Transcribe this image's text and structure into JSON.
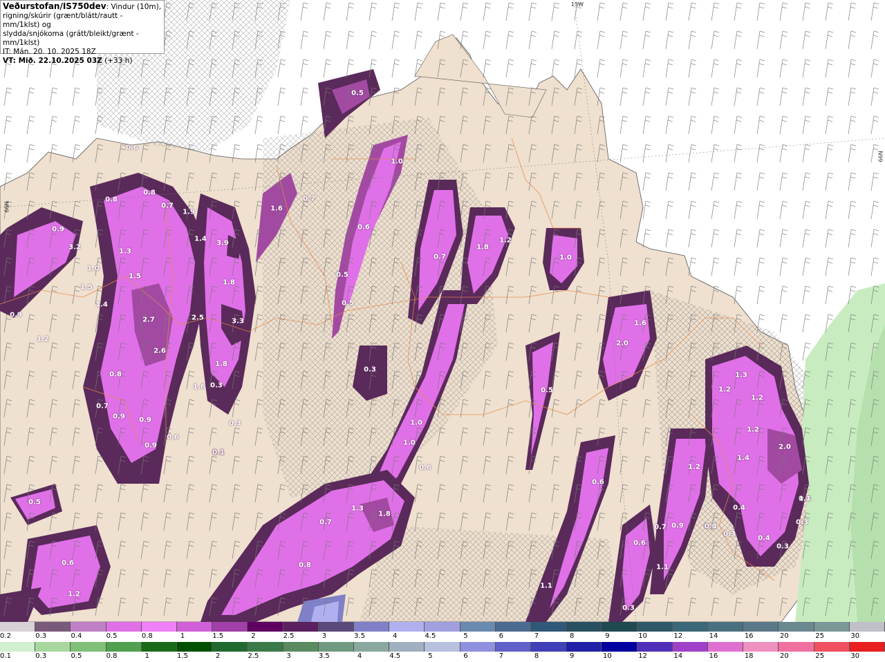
{
  "header": {
    "brand": "Veðurstofan/IS750dev",
    "line1_rest": ": Vindur (10m),",
    "line2": "rigning/skúrir (grænt/blátt/rautt - mm/1klst) og",
    "line3": "slydda/snjókoma (grátt/bleikt/grænt - mm/1klst)",
    "line4": "IT: Mán. 20. 10. 2025 18Z",
    "line5_bold": "VT: Mið. 22.10.2025 03Z",
    "line5_rest": " (+33 h)"
  },
  "grid_labels": {
    "lon_top": "15W",
    "lat_left": "66N",
    "lat_right": "66N"
  },
  "map_colors": {
    "land": "#efe0cf",
    "sea": "#ffffff",
    "roads": "#e8894a",
    "snow_dark": "#5a2a5a",
    "snow_mid": "#a24aa2",
    "snow_bright": "#e070e8",
    "rain_light": "#c8ecc0"
  },
  "value_labels": [
    {
      "text": "0.5"
    },
    {
      "text": "0.6"
    },
    {
      "text": "0.8"
    },
    {
      "text": "0.8"
    },
    {
      "text": "0.7"
    },
    {
      "text": "1.9"
    },
    {
      "text": "0.9"
    },
    {
      "text": "3.2"
    },
    {
      "text": "1.3"
    },
    {
      "text": "1.0"
    },
    {
      "text": "1.5"
    },
    {
      "text": "1.5"
    },
    {
      "text": "1.4"
    },
    {
      "text": "1.4"
    },
    {
      "text": "3.9"
    },
    {
      "text": "1.8"
    },
    {
      "text": "1.6"
    },
    {
      "text": "0.7"
    },
    {
      "text": "1.0"
    },
    {
      "text": "0.6"
    },
    {
      "text": "0.5"
    },
    {
      "text": "0.5"
    },
    {
      "text": "0.7"
    },
    {
      "text": "1.8"
    },
    {
      "text": "1.2"
    },
    {
      "text": "1.0"
    },
    {
      "text": "0.9"
    },
    {
      "text": "1.2"
    },
    {
      "text": "2.7"
    },
    {
      "text": "2.5"
    },
    {
      "text": "3.3"
    },
    {
      "text": "2.6"
    },
    {
      "text": "1.8"
    },
    {
      "text": "0.8"
    },
    {
      "text": "1.6"
    },
    {
      "text": "0.7"
    },
    {
      "text": "0.9"
    },
    {
      "text": "0.9"
    },
    {
      "text": "0.3"
    },
    {
      "text": "0.6"
    },
    {
      "text": "0.9"
    },
    {
      "text": "0.1"
    },
    {
      "text": "0.3"
    },
    {
      "text": "0.3"
    },
    {
      "text": "1.0"
    },
    {
      "text": "1.0"
    },
    {
      "text": "0.6"
    },
    {
      "text": "0.5"
    },
    {
      "text": "2.0"
    },
    {
      "text": "1.6"
    },
    {
      "text": "1.3"
    },
    {
      "text": "1.2"
    },
    {
      "text": "1.2"
    },
    {
      "text": "1.2"
    },
    {
      "text": "2.0"
    },
    {
      "text": "1.4"
    },
    {
      "text": "1.2"
    },
    {
      "text": "0.6"
    },
    {
      "text": "0.5"
    },
    {
      "text": "0.6"
    },
    {
      "text": "0.7"
    },
    {
      "text": "1.3"
    },
    {
      "text": "1.8"
    },
    {
      "text": "0.8"
    },
    {
      "text": "1.2"
    },
    {
      "text": "0.6"
    },
    {
      "text": "0.7"
    },
    {
      "text": "0.3"
    },
    {
      "text": "0.6"
    },
    {
      "text": "1.1"
    },
    {
      "text": "0.9"
    },
    {
      "text": "0.4"
    },
    {
      "text": "0.4"
    },
    {
      "text": "0.3"
    },
    {
      "text": "0.4"
    },
    {
      "text": "0.3"
    },
    {
      "text": "1.1"
    },
    {
      "text": "0.4"
    },
    {
      "text": "0.3"
    },
    {
      "text": "1.1"
    },
    {
      "text": "0.1"
    }
  ],
  "colorbar_snow": {
    "labels": [
      "0.2",
      "0.3",
      "0.4",
      "0.5",
      "0.8",
      "1",
      "1.5",
      "2",
      "2.5",
      "3",
      "3.5",
      "4",
      "4.5",
      "5",
      "6",
      "7",
      "8",
      "9",
      "10",
      "12",
      "14",
      "16",
      "20",
      "25",
      "30"
    ],
    "colors": [
      "#d8d2d8",
      "#7a5a7a",
      "#c080c8",
      "#e070e8",
      "#f080f8",
      "#d060d8",
      "#a040a8",
      "#600060",
      "#5a2060",
      "#5a4a7a",
      "#8080c8",
      "#b0b0f0",
      "#a0a0e0",
      "#6a8ab0",
      "#4a6a90",
      "#305878",
      "#285060",
      "#204a50",
      "#305868",
      "#3a6878",
      "#4a7080",
      "#5a7888",
      "#6a8890",
      "#7a9898",
      "#c0c0c8"
    ]
  },
  "colorbar_rain": {
    "labels": [
      "0.1",
      "0.3",
      "0.5",
      "0.8",
      "1",
      "1.5",
      "2",
      "2.5",
      "3",
      "3.5",
      "4",
      "4.5",
      "5",
      "6",
      "7",
      "8",
      "9",
      "10",
      "12",
      "14",
      "16",
      "18",
      "20",
      "25",
      "30"
    ],
    "colors": [
      "#d0f0d0",
      "#a8d8a0",
      "#80c078",
      "#50a050",
      "#1a6a1a",
      "#005000",
      "#206a30",
      "#3a7a48",
      "#5a8a60",
      "#709a80",
      "#8aa8a0",
      "#a0b0c0",
      "#b8c0e0",
      "#9090e0",
      "#6060c8",
      "#4040b8",
      "#2020a8",
      "#0000a0",
      "#5030b8",
      "#a040c8",
      "#e070d0",
      "#f090c0",
      "#f070a0",
      "#f05060",
      "#e82020"
    ]
  }
}
